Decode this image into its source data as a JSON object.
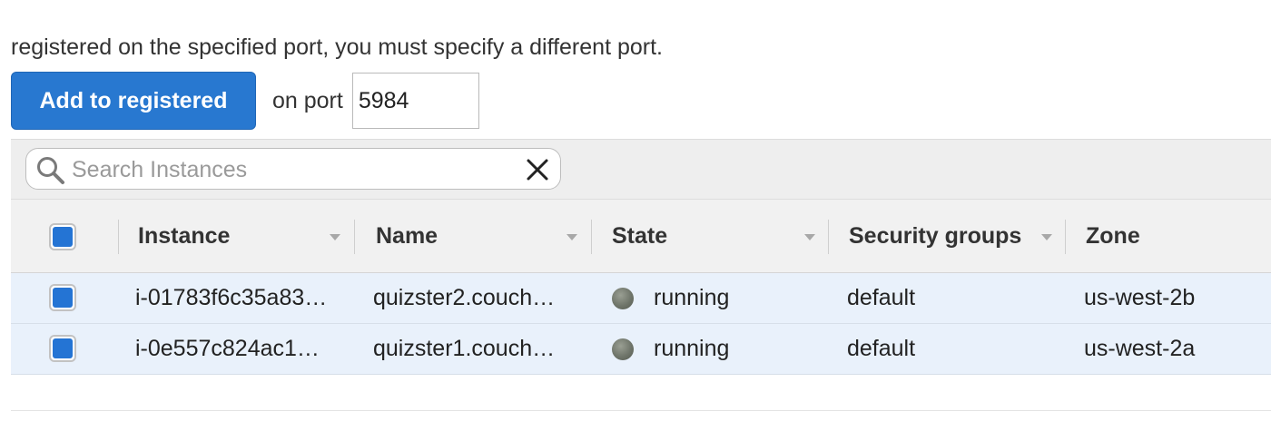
{
  "intro": {
    "line2": "registered on the specified port, you must specify a different port."
  },
  "actions": {
    "add_button_label": "Add to registered",
    "port_label": "on port",
    "port_value": "5984"
  },
  "search": {
    "placeholder": "Search Instances",
    "value": ""
  },
  "table": {
    "columns": [
      "Instance",
      "Name",
      "State",
      "Security groups",
      "Zone"
    ],
    "rows": [
      {
        "selected": true,
        "instance": "i-01783f6c35a83…",
        "name": "quizster2.couch…",
        "state": "running",
        "security_groups": "default",
        "zone": "us-west-2b"
      },
      {
        "selected": true,
        "instance": "i-0e557c824ac1…",
        "name": "quizster1.couch…",
        "state": "running",
        "security_groups": "default",
        "zone": "us-west-2a"
      }
    ]
  },
  "colors": {
    "primary_button": "#2878d0",
    "checkbox_fill": "#2474d4",
    "selected_row": "#e9f1fb",
    "state_running_dot": "#6f756a"
  }
}
